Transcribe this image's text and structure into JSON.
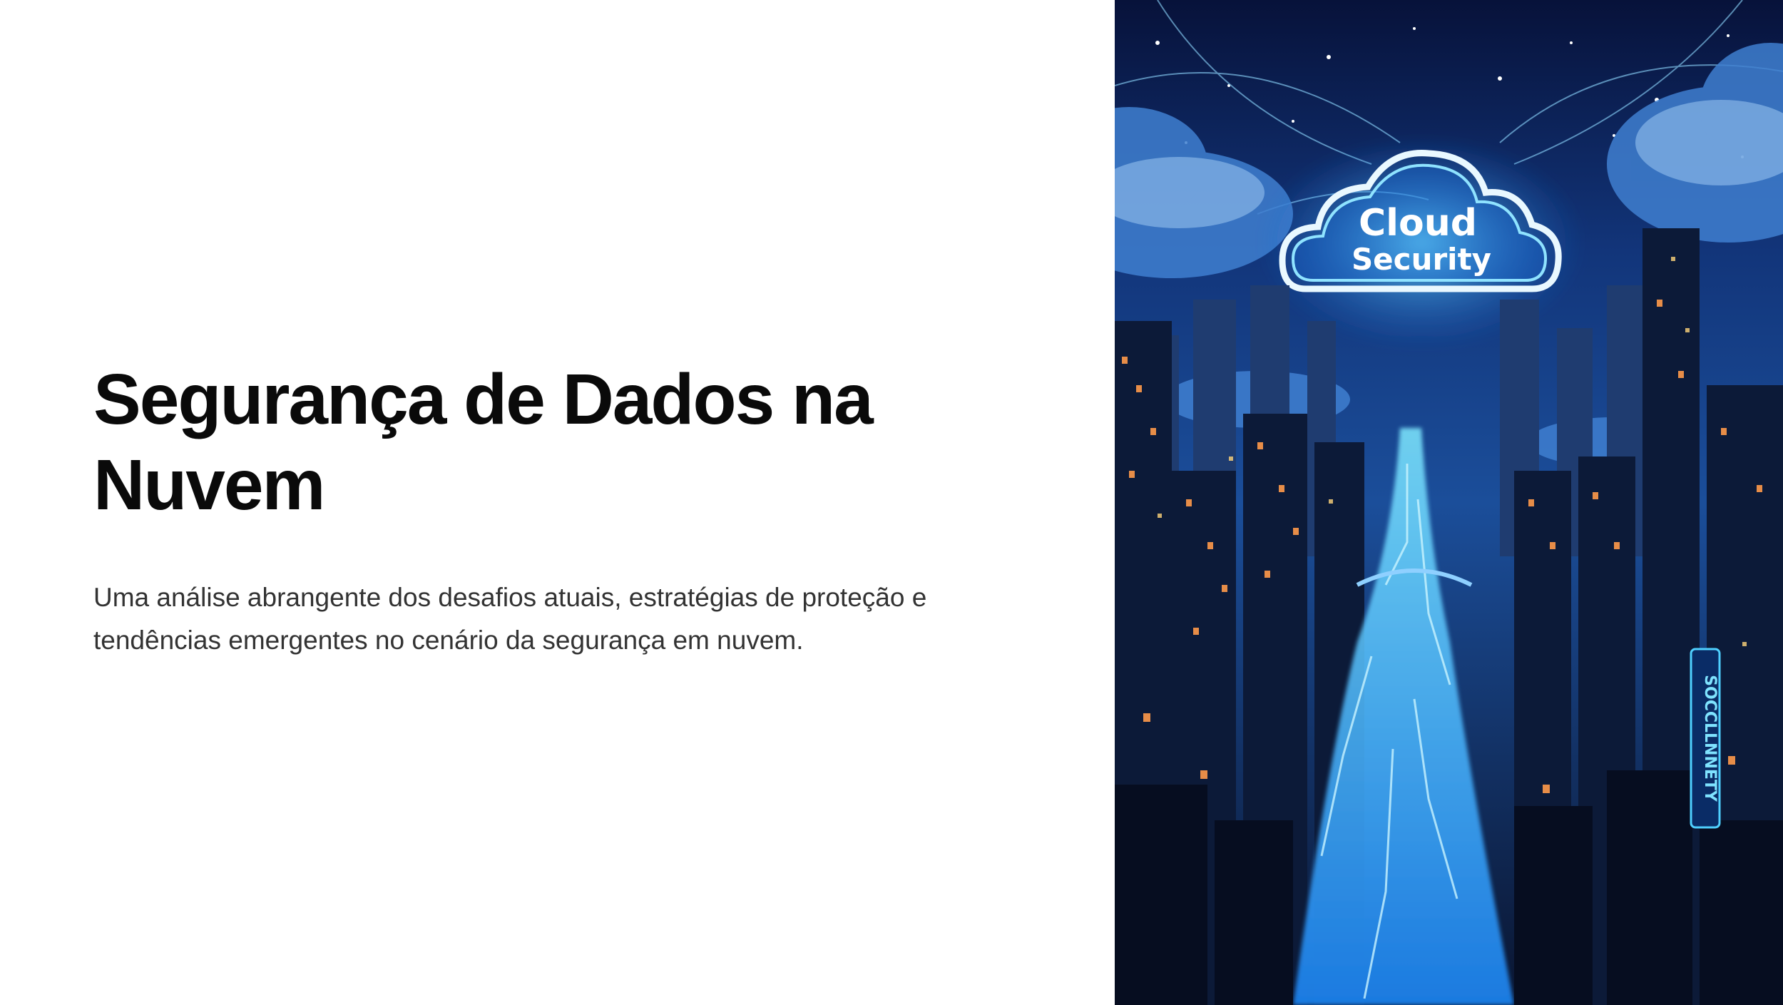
{
  "slide": {
    "title": "Segurança de Dados na\nNuvem",
    "subtitle": "Uma análise abrangente dos desafios atuais, estratégias de proteção e tendências emergentes no cenário da segurança em nuvem."
  },
  "illustration": {
    "cloud_line1": "Cloud",
    "cloud_line2": "Security",
    "neon_sign": "SOCCLLNNETY"
  },
  "colors": {
    "title": "#0a0a0a",
    "subtitle": "#333333",
    "sky": "#0b1e4a",
    "neon_blue": "#38c8ff",
    "window_orange": "#ff8a3c"
  }
}
